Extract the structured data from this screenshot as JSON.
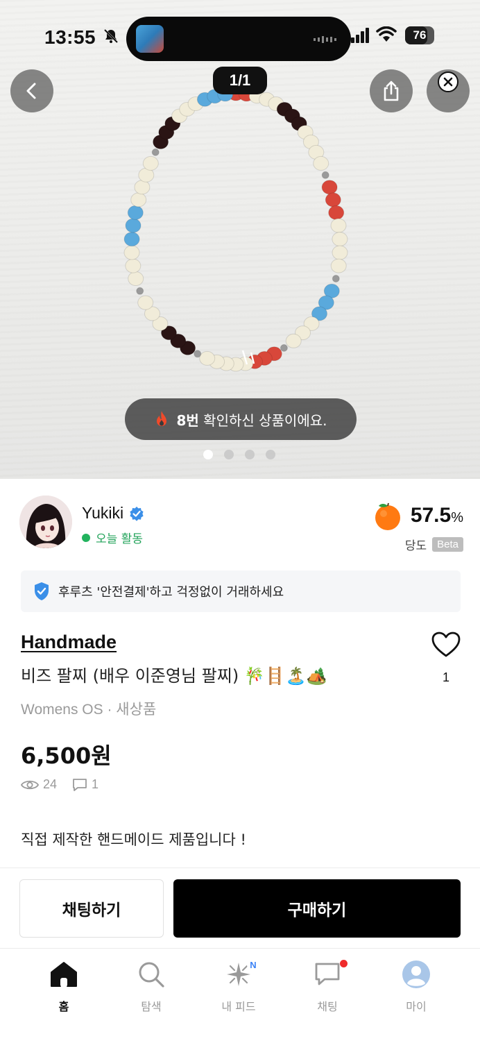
{
  "status_bar": {
    "time": "13:55",
    "battery": "76",
    "battery_level": 0.76
  },
  "gallery": {
    "counter": "1/1",
    "views_notice_count": "8번",
    "views_notice_text": " 확인하신 상품이에요.",
    "dots": 4,
    "active_dot": 0
  },
  "seller": {
    "name": "Yukiki",
    "activity": "오늘 활동",
    "temperature": "57.5",
    "temperature_unit": "%",
    "temperature_label": "당도",
    "beta": "Beta"
  },
  "safe_pay": {
    "text": "후루츠 '안전결제'하고 걱정없이 거래하세요"
  },
  "product": {
    "brand": "Handmade",
    "title": "비즈 팔찌 (배우 이준영님 팔찌) 🎋🪜🏝️🏕️",
    "meta": "Womens OS · 새상품",
    "price": "6,500원",
    "views": "24",
    "comments": "1",
    "likes": "1",
    "description": "직접 제작한 핸드메이드 제품입니다 !"
  },
  "actions": {
    "chat": "채팅하기",
    "buy": "구매하기"
  },
  "tabs": [
    {
      "label": "홈",
      "icon": "home-icon"
    },
    {
      "label": "탐색",
      "icon": "search-icon"
    },
    {
      "label": "내 피드",
      "icon": "sparkle-icon",
      "badge": "N"
    },
    {
      "label": "채팅",
      "icon": "chat-icon"
    },
    {
      "label": "마이",
      "icon": "profile-icon"
    }
  ],
  "colors": {
    "accent_green": "#22b35e",
    "verified_blue": "#3b8fe8",
    "notification_red": "#ef2b2b",
    "primary_button": "#000000"
  }
}
